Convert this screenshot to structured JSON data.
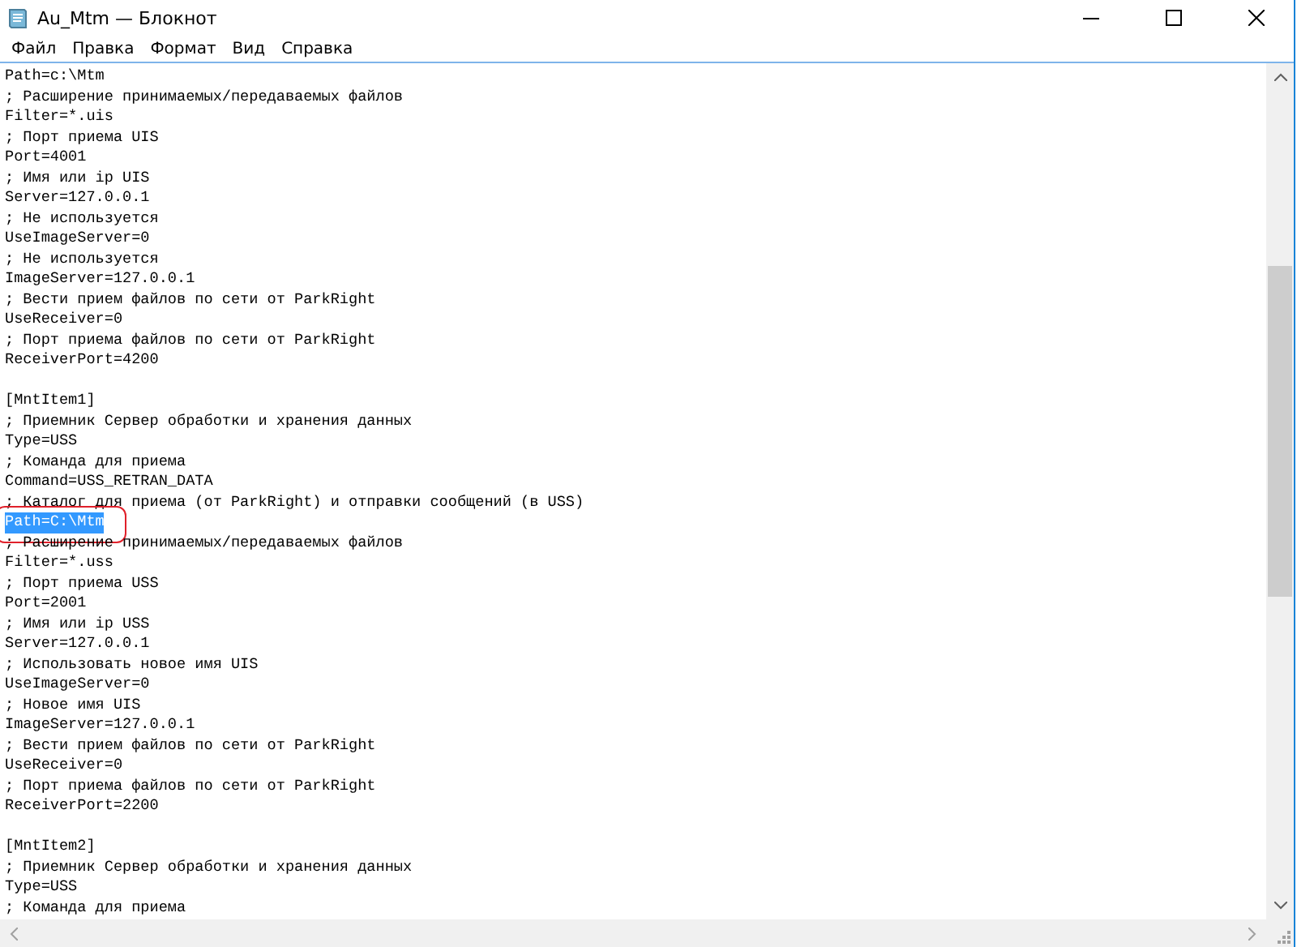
{
  "window": {
    "title": "Au_Mtm — Блокнот"
  },
  "menu": [
    "Файл",
    "Правка",
    "Формат",
    "Вид",
    "Справка"
  ],
  "editor": {
    "lines": [
      {
        "kind": "text",
        "text": "Path=c:\\Mtm",
        "selected": false,
        "circled": false
      },
      {
        "kind": "text",
        "text": "; Расширение принимаемых/передаваемых файлов",
        "selected": false,
        "circled": false
      },
      {
        "kind": "text",
        "text": "Filter=*.uis",
        "selected": false,
        "circled": false
      },
      {
        "kind": "text",
        "text": "; Порт приема UIS",
        "selected": false,
        "circled": false
      },
      {
        "kind": "text",
        "text": "Port=4001",
        "selected": false,
        "circled": false
      },
      {
        "kind": "text",
        "text": "; Имя или ip UIS",
        "selected": false,
        "circled": false
      },
      {
        "kind": "text",
        "text": "Server=127.0.0.1",
        "selected": false,
        "circled": false
      },
      {
        "kind": "text",
        "text": "; Не используется",
        "selected": false,
        "circled": false
      },
      {
        "kind": "text",
        "text": "UseImageServer=0",
        "selected": false,
        "circled": false
      },
      {
        "kind": "text",
        "text": "; Не используется",
        "selected": false,
        "circled": false
      },
      {
        "kind": "text",
        "text": "ImageServer=127.0.0.1",
        "selected": false,
        "circled": false
      },
      {
        "kind": "text",
        "text": "; Вести прием файлов по сети от ParkRight",
        "selected": false,
        "circled": false
      },
      {
        "kind": "text",
        "text": "UseReceiver=0",
        "selected": false,
        "circled": false
      },
      {
        "kind": "text",
        "text": "; Порт приема файлов по сети от ParkRight",
        "selected": false,
        "circled": false
      },
      {
        "kind": "text",
        "text": "ReceiverPort=4200",
        "selected": false,
        "circled": false
      },
      {
        "kind": "blank"
      },
      {
        "kind": "text",
        "text": "[MntItem1]",
        "selected": false,
        "circled": false
      },
      {
        "kind": "text",
        "text": "; Приемник Сервер обработки и хранения данных",
        "selected": false,
        "circled": false
      },
      {
        "kind": "text",
        "text": "Type=USS",
        "selected": false,
        "circled": false
      },
      {
        "kind": "text",
        "text": "; Команда для приема",
        "selected": false,
        "circled": false
      },
      {
        "kind": "text",
        "text": "Command=USS_RETRAN_DATA",
        "selected": false,
        "circled": false
      },
      {
        "kind": "text",
        "text": "; Каталог для приема (от ParkRight) и отправки сообщений (в USS)",
        "selected": false,
        "circled": false
      },
      {
        "kind": "text",
        "text": "Path=C:\\Mtm",
        "selected": true,
        "circled": true
      },
      {
        "kind": "text",
        "text": "; Расширение принимаемых/передаваемых файлов",
        "selected": false,
        "circled": false
      },
      {
        "kind": "text",
        "text": "Filter=*.uss",
        "selected": false,
        "circled": false
      },
      {
        "kind": "text",
        "text": "; Порт приема USS",
        "selected": false,
        "circled": false
      },
      {
        "kind": "text",
        "text": "Port=2001",
        "selected": false,
        "circled": false
      },
      {
        "kind": "text",
        "text": "; Имя или ip USS",
        "selected": false,
        "circled": false
      },
      {
        "kind": "text",
        "text": "Server=127.0.0.1",
        "selected": false,
        "circled": false
      },
      {
        "kind": "text",
        "text": "; Использовать новое имя UIS",
        "selected": false,
        "circled": false
      },
      {
        "kind": "text",
        "text": "UseImageServer=0",
        "selected": false,
        "circled": false
      },
      {
        "kind": "text",
        "text": "; Новое имя UIS",
        "selected": false,
        "circled": false
      },
      {
        "kind": "text",
        "text": "ImageServer=127.0.0.1",
        "selected": false,
        "circled": false
      },
      {
        "kind": "text",
        "text": "; Вести прием файлов по сети от ParkRight",
        "selected": false,
        "circled": false
      },
      {
        "kind": "text",
        "text": "UseReceiver=0",
        "selected": false,
        "circled": false
      },
      {
        "kind": "text",
        "text": "; Порт приема файлов по сети от ParkRight",
        "selected": false,
        "circled": false
      },
      {
        "kind": "text",
        "text": "ReceiverPort=2200",
        "selected": false,
        "circled": false
      },
      {
        "kind": "blank"
      },
      {
        "kind": "text",
        "text": "[MntItem2]",
        "selected": false,
        "circled": false
      },
      {
        "kind": "text",
        "text": "; Приемник Сервер обработки и хранения данных",
        "selected": false,
        "circled": false
      },
      {
        "kind": "text",
        "text": "Type=USS",
        "selected": false,
        "circled": false
      },
      {
        "kind": "text",
        "text": "; Команда для приема",
        "selected": false,
        "circled": false
      }
    ]
  }
}
